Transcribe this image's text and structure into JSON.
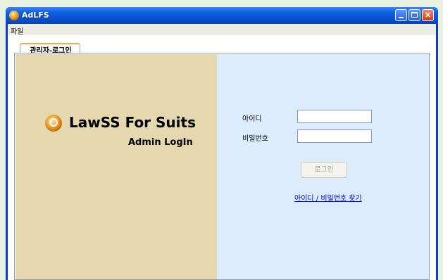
{
  "window": {
    "title": "AdLFS",
    "icon": "app-icon",
    "controls": {
      "minimize": "minimize-icon",
      "maximize": "maximize-icon",
      "close": "×"
    },
    "accent_color": "#0a4fd0"
  },
  "menubar": {
    "items": [
      {
        "label": "파일"
      }
    ]
  },
  "tabs": [
    {
      "label": "관리자-로그인",
      "selected": true
    }
  ],
  "brand": {
    "title": "LawSS For Suits",
    "subtitle": "Admin LogIn",
    "left_pane_color": "#e6d8ae",
    "right_pane_color": "#dcecfd"
  },
  "login": {
    "id_label": "아이디",
    "id_value": "",
    "password_label": "비밀번호",
    "password_value": "",
    "button_label": "로그인",
    "button_enabled": false,
    "find_link": "아이디 / 비밀번호 찾기"
  }
}
